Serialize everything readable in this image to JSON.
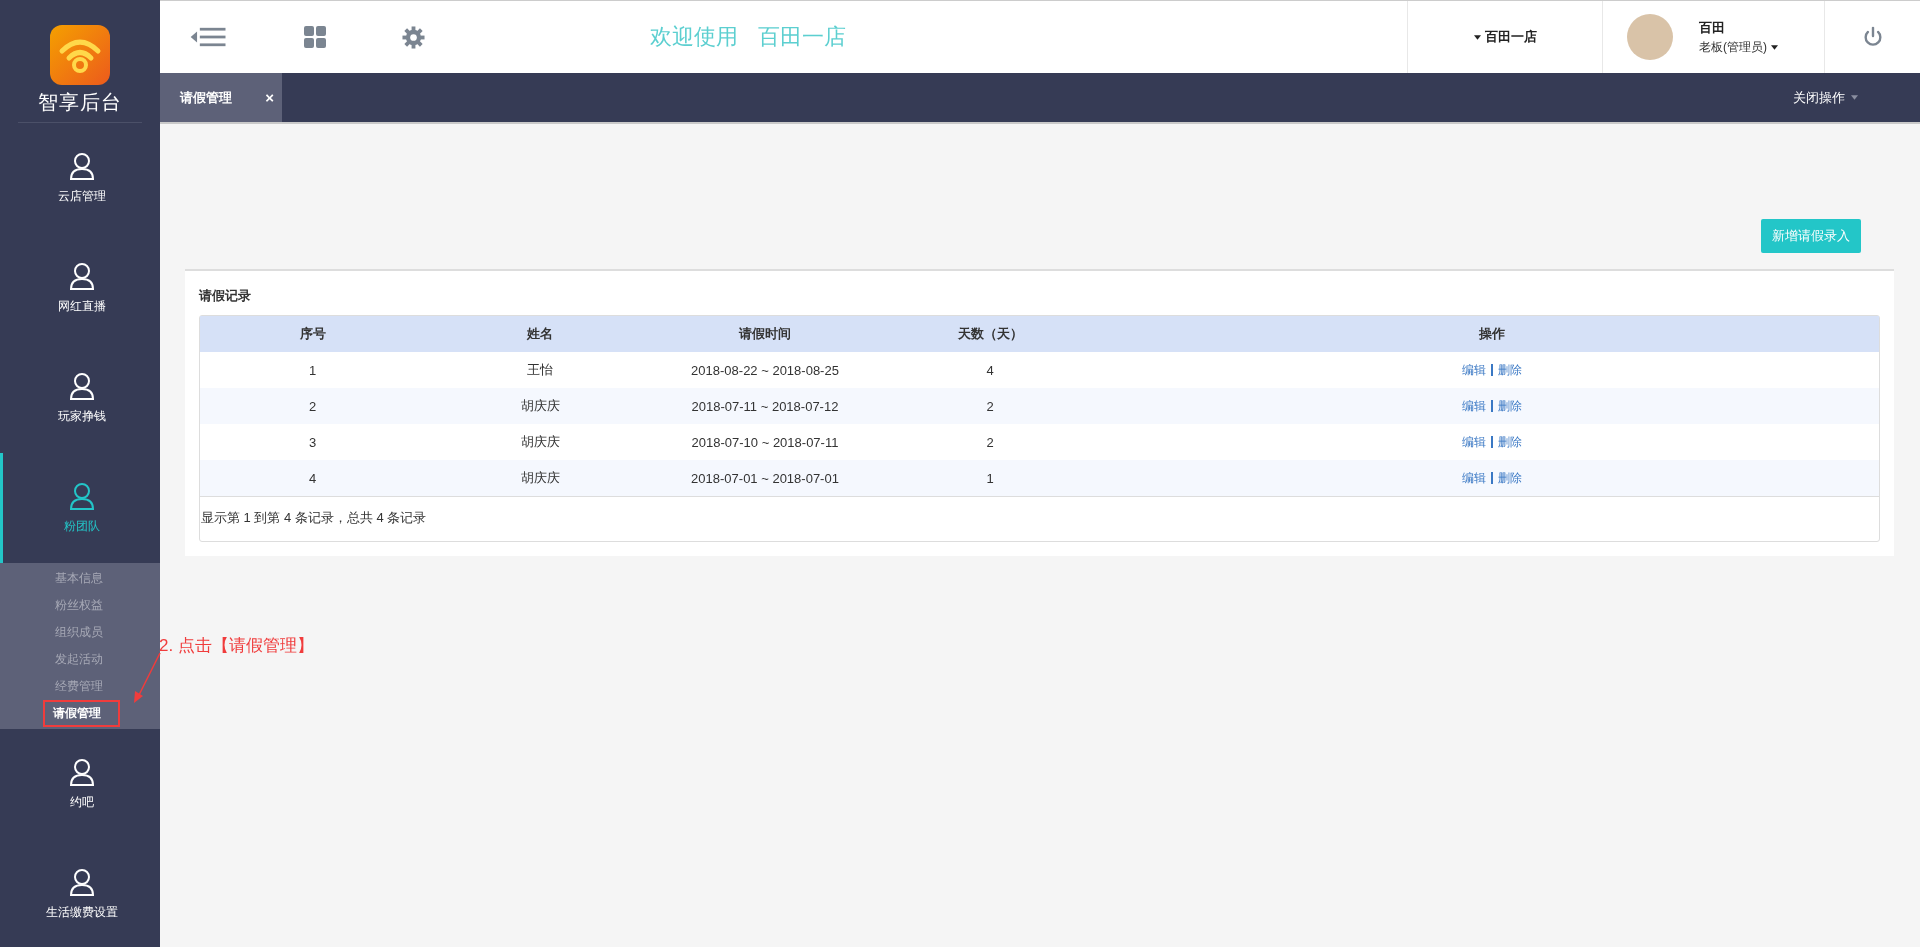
{
  "sidebar": {
    "logo_text": "智享后台",
    "items": [
      {
        "label": "云店管理",
        "selected": false
      },
      {
        "label": "网红直播",
        "selected": false
      },
      {
        "label": "玩家挣钱",
        "selected": false
      },
      {
        "label": "粉团队",
        "selected": true,
        "children": [
          {
            "label": "基本信息",
            "selected": false,
            "highlight_box": false
          },
          {
            "label": "粉丝权益",
            "selected": false,
            "highlight_box": false
          },
          {
            "label": "组织成员",
            "selected": false,
            "highlight_box": false
          },
          {
            "label": "发起活动",
            "selected": false,
            "highlight_box": false
          },
          {
            "label": "经费管理",
            "selected": false,
            "highlight_box": false
          },
          {
            "label": "请假管理",
            "selected": true,
            "highlight_box": true
          }
        ]
      },
      {
        "label": "约吧",
        "selected": false
      },
      {
        "label": "生活缴费设置",
        "selected": false
      }
    ]
  },
  "header": {
    "welcome": "欢迎使用",
    "store_name": "百田一店",
    "store_dropdown": "百田一店",
    "user_name": "百田",
    "user_role": "老板(管理员)"
  },
  "tabs": [
    {
      "label": "请假管理",
      "selected": true,
      "close": "×"
    }
  ],
  "tab_actions": "关闭操作",
  "annotation": {
    "text": "2. 点击【请假管理】"
  },
  "main": {
    "add_button": "新增请假录入",
    "card_title": "请假记录",
    "table": {
      "columns": [
        "序号",
        "姓名",
        "请假时间",
        "天数（天）",
        "操作"
      ],
      "rows": [
        {
          "cells": [
            "1",
            "王怡",
            "2018-08-22 ~ 2018-08-25",
            "4"
          ],
          "actions": [
            "编辑",
            "删除"
          ]
        },
        {
          "cells": [
            "2",
            "胡庆庆",
            "2018-07-11 ~ 2018-07-12",
            "2"
          ],
          "actions": [
            "编辑",
            "删除"
          ]
        },
        {
          "cells": [
            "3",
            "胡庆庆",
            "2018-07-10 ~ 2018-07-11",
            "2"
          ],
          "actions": [
            "编辑",
            "删除"
          ]
        },
        {
          "cells": [
            "4",
            "胡庆庆",
            "2018-07-01 ~ 2018-07-01",
            "1"
          ],
          "actions": [
            "编辑",
            "删除"
          ]
        }
      ]
    },
    "footer": "显示第 1 到第 4 条记录，总共 4 条记录"
  }
}
